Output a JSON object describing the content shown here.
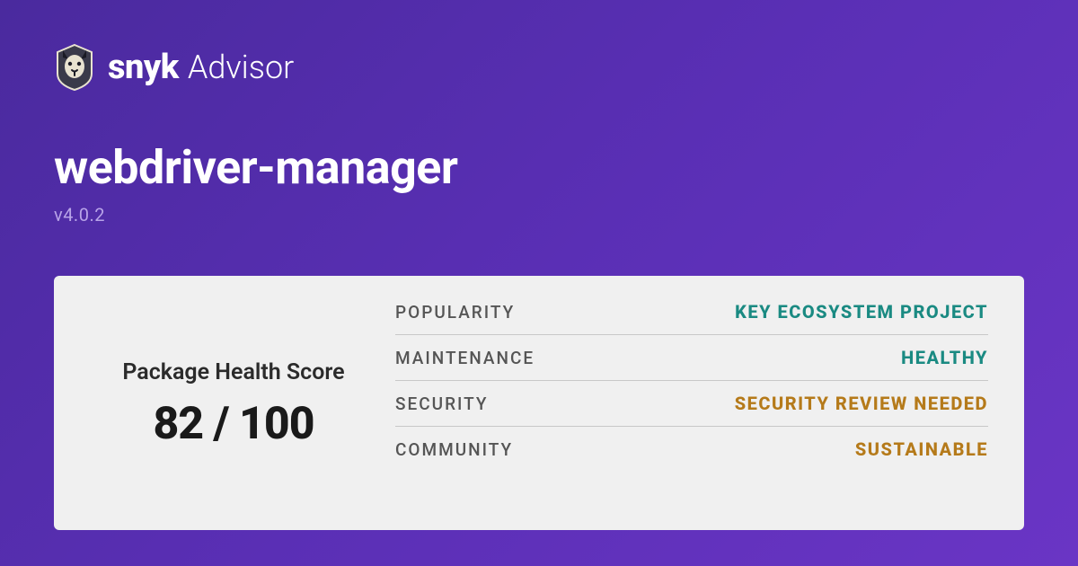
{
  "brand": {
    "bold": "snyk",
    "light": "Advisor"
  },
  "package": {
    "name": "webdriver-manager",
    "version": "v4.0.2"
  },
  "score": {
    "label": "Package Health Score",
    "value": "82 / 100"
  },
  "metrics": [
    {
      "label": "POPULARITY",
      "value": "KEY ECOSYSTEM PROJECT",
      "color": "teal"
    },
    {
      "label": "MAINTENANCE",
      "value": "HEALTHY",
      "color": "teal"
    },
    {
      "label": "SECURITY",
      "value": "SECURITY REVIEW NEEDED",
      "color": "amber"
    },
    {
      "label": "COMMUNITY",
      "value": "SUSTAINABLE",
      "color": "amber"
    }
  ]
}
